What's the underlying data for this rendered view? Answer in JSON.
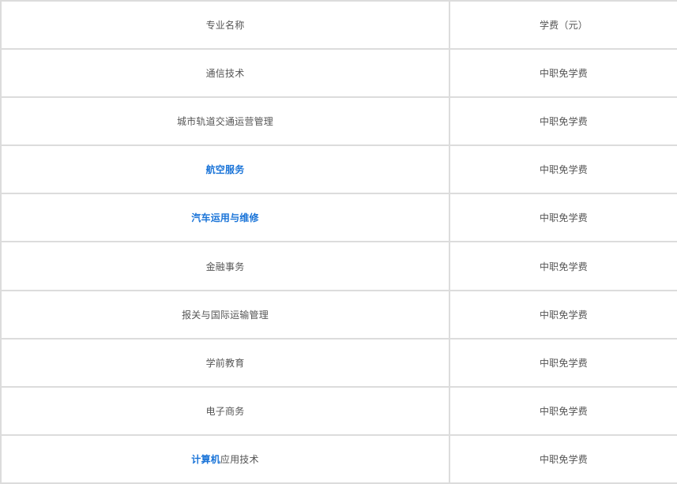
{
  "table": {
    "header": {
      "major": "专业名称",
      "fee": "学费（元）"
    },
    "rows": [
      {
        "major": "通信技术",
        "fee": "中职免学费"
      },
      {
        "major": "城市轨道交通运营管理",
        "fee": "中职免学费"
      },
      {
        "major": "航空服务",
        "fee": "中职免学费"
      },
      {
        "major": "汽车运用与维修",
        "fee": "中职免学费"
      },
      {
        "major": "金融事务",
        "fee": "中职免学费"
      },
      {
        "major": "报关与国际运输管理",
        "fee": "中职免学费"
      },
      {
        "major": "学前教育",
        "fee": "中职免学费"
      },
      {
        "major": "电子商务",
        "fee": "中职免学费"
      },
      {
        "major_link": "计算机",
        "major_rest": "应用技术",
        "fee": "中职免学费"
      }
    ]
  },
  "colors": {
    "link": "#1a74d8",
    "text": "#555555",
    "border": "#dcdcdc"
  }
}
